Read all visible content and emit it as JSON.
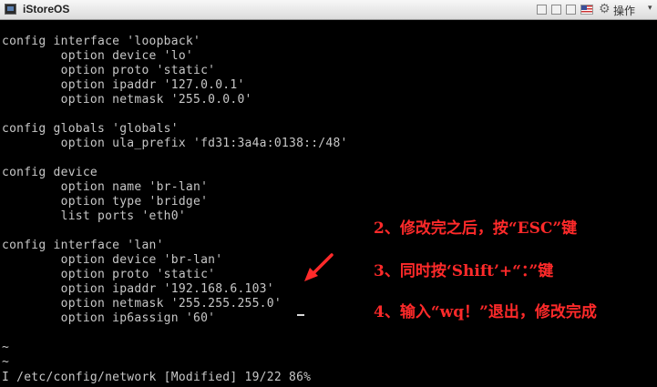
{
  "window": {
    "title": "iStoreOS",
    "op_label": "操作"
  },
  "colors": {
    "annotation": "#ff2a2a",
    "terminal_text": "#c7c7c7",
    "terminal_bg": "#000000"
  },
  "terminal": {
    "lines": [
      "config interface 'loopback'",
      "        option device 'lo'",
      "        option proto 'static'",
      "        option ipaddr '127.0.0.1'",
      "        option netmask '255.0.0.0'",
      "",
      "config globals 'globals'",
      "        option ula_prefix 'fd31:3a4a:0138::/48'",
      "",
      "config device",
      "        option name 'br-lan'",
      "        option type 'bridge'",
      "        list ports 'eth0'",
      "",
      "config interface 'lan'",
      "        option device 'br-lan'",
      "        option proto 'static'",
      "        option ipaddr '192.168.6.103'",
      "        option netmask '255.255.255.0'",
      "        option ip6assign '60'",
      "",
      "~",
      "~",
      "I /etc/config/network [Modified] 19/22 86%"
    ]
  },
  "annotations": {
    "step2": "2、修改完之后，按“ESC”键",
    "step3": "3、同时按‘Shift’+“：”键",
    "step4": "4、输入“wq！”退出，修改完成"
  },
  "icons": {
    "app": "terminal-icon",
    "gear": "gear-icon",
    "flag": "us-flag-icon"
  }
}
